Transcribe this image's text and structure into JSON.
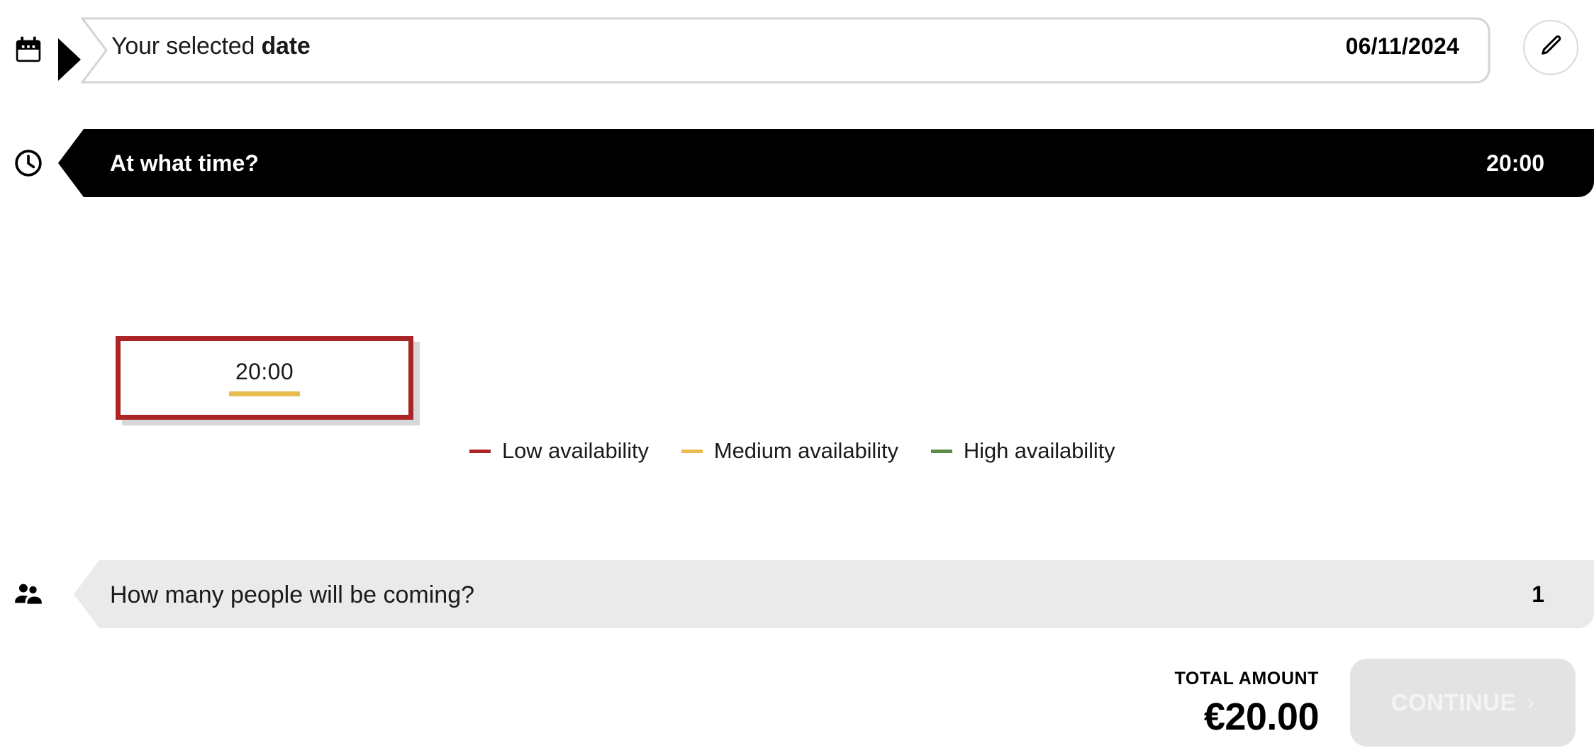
{
  "date_row": {
    "icon": "calendar-icon",
    "label_prefix": "Your selected ",
    "label_strong": "date",
    "value": "06/11/2024",
    "edit_icon": "pencil-icon"
  },
  "time_row": {
    "icon": "clock-icon",
    "label": "At what time?",
    "value": "20:00"
  },
  "time_slots": [
    {
      "time": "20:00",
      "availability": "medium",
      "selected": true,
      "underline_color": "#e8bc4f",
      "border_color": "#ab2526"
    }
  ],
  "legend": {
    "items": [
      {
        "label": "Low availability",
        "color": "#ab2526"
      },
      {
        "label": "Medium availability",
        "color": "#e8bc4f"
      },
      {
        "label": "High availability",
        "color": "#5d8a46"
      }
    ]
  },
  "people_row": {
    "icon": "people-icon",
    "label": "How many people will be coming?",
    "value": "1"
  },
  "footer": {
    "total_label": "TOTAL AMOUNT",
    "total_value": "€20.00",
    "continue_label": "CONTINUE",
    "continue_chevron": "›",
    "continue_disabled": true
  },
  "colors": {
    "accent_red": "#ab2526",
    "accent_amber": "#e8bc4f",
    "accent_green": "#5d8a46",
    "bar_dark": "#000000",
    "bar_grey": "#eaeaea",
    "button_disabled": "#e3e3e3"
  }
}
